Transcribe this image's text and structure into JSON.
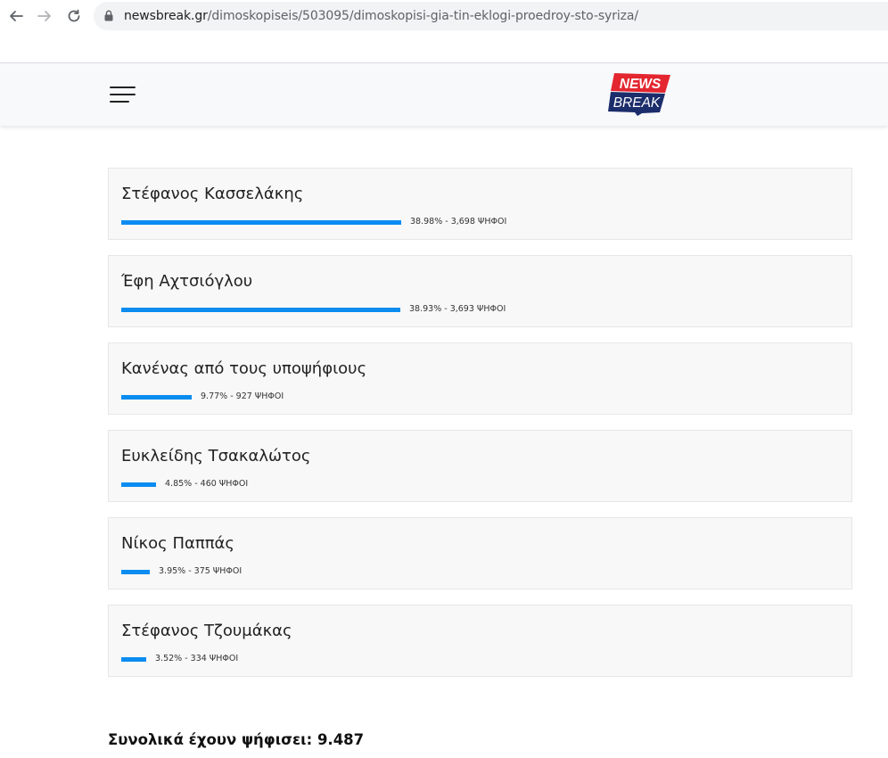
{
  "browser": {
    "url_host": "newsbreak.gr",
    "url_path": "/dimoskopiseis/503095/dimoskopisi-gia-tin-eklogi-proedroy-sto-syriza/"
  },
  "site": {
    "logo_line1": "NEWS",
    "logo_line2": "BREAK",
    "brand_colors": {
      "red": "#e3262f",
      "navy": "#1c2d6b"
    }
  },
  "poll": {
    "bar_color": "#0a8cf0",
    "options": [
      {
        "name": "Στέφανος Κασσελάκης",
        "percent": 38.98,
        "stat": "38.98% - 3,698 ΨΗΦΟΙ"
      },
      {
        "name": "Έφη Αχτσιόγλου",
        "percent": 38.93,
        "stat": "38.93% - 3,693 ΨΗΦΟΙ"
      },
      {
        "name": "Κανένας από τους υποψήφιους",
        "percent": 9.77,
        "stat": "9.77% - 927 ΨΗΦΟΙ"
      },
      {
        "name": "Ευκλείδης Τσακαλώτος",
        "percent": 4.85,
        "stat": "4.85% - 460 ΨΗΦΟΙ"
      },
      {
        "name": "Νίκος Παππάς",
        "percent": 3.95,
        "stat": "3.95% - 375 ΨΗΦΟΙ"
      },
      {
        "name": "Στέφανος Τζουμάκας",
        "percent": 3.52,
        "stat": "3.52% - 334 ΨΗΦΟΙ"
      }
    ],
    "total": "Συνολικά έχουν ψήφισει: 9.487"
  }
}
